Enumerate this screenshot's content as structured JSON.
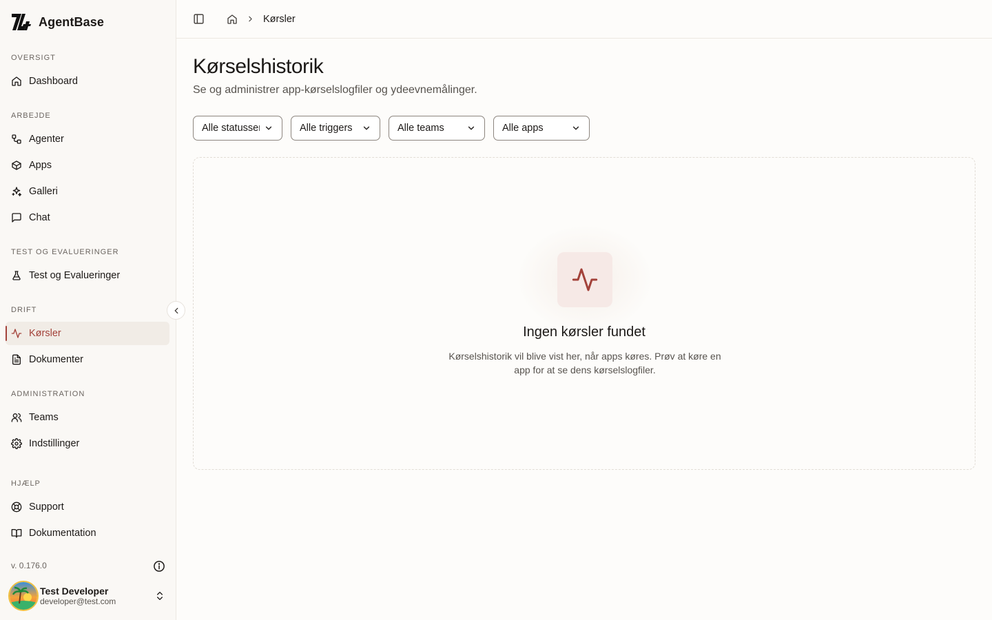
{
  "brand": {
    "name": "AgentBase"
  },
  "sidebar": {
    "sections": {
      "overview": "OVERSIGT",
      "work": "ARBEJDE",
      "test": "TEST OG EVALUERINGER",
      "ops": "DRIFT",
      "admin": "ADMINISTRATION",
      "help": "HJÆLP"
    },
    "items": {
      "dashboard": "Dashboard",
      "agents": "Agenter",
      "apps": "Apps",
      "gallery": "Galleri",
      "chat": "Chat",
      "tests": "Test og Evalueringer",
      "runs": "Kørsler",
      "documents": "Dokumenter",
      "teams": "Teams",
      "settings": "Indstillinger",
      "support": "Support",
      "docs": "Dokumentation"
    },
    "active_item": "runs",
    "version": "v. 0.176.0",
    "user": {
      "name": "Test Developer",
      "email": "developer@test.com"
    }
  },
  "breadcrumb": {
    "current": "Kørsler"
  },
  "page": {
    "title": "Kørselshistorik",
    "subtitle": "Se og administrer app-kørselslogfiler og ydeevnemålinger."
  },
  "filters": {
    "status": "Alle statusser",
    "triggers": "Alle triggers",
    "teams": "Alle teams",
    "apps": "Alle apps"
  },
  "empty_state": {
    "icon": "activity-icon",
    "title": "Ingen kørsler fundet",
    "description": "Kørselshistorik vil blive vist her, når apps køres. Prøv at køre en app for at se dens kørselslogfiler."
  },
  "colors": {
    "accent": "#a3423a",
    "sidebar_bg": "#faf8f5",
    "active_bg": "#f1ece6"
  }
}
